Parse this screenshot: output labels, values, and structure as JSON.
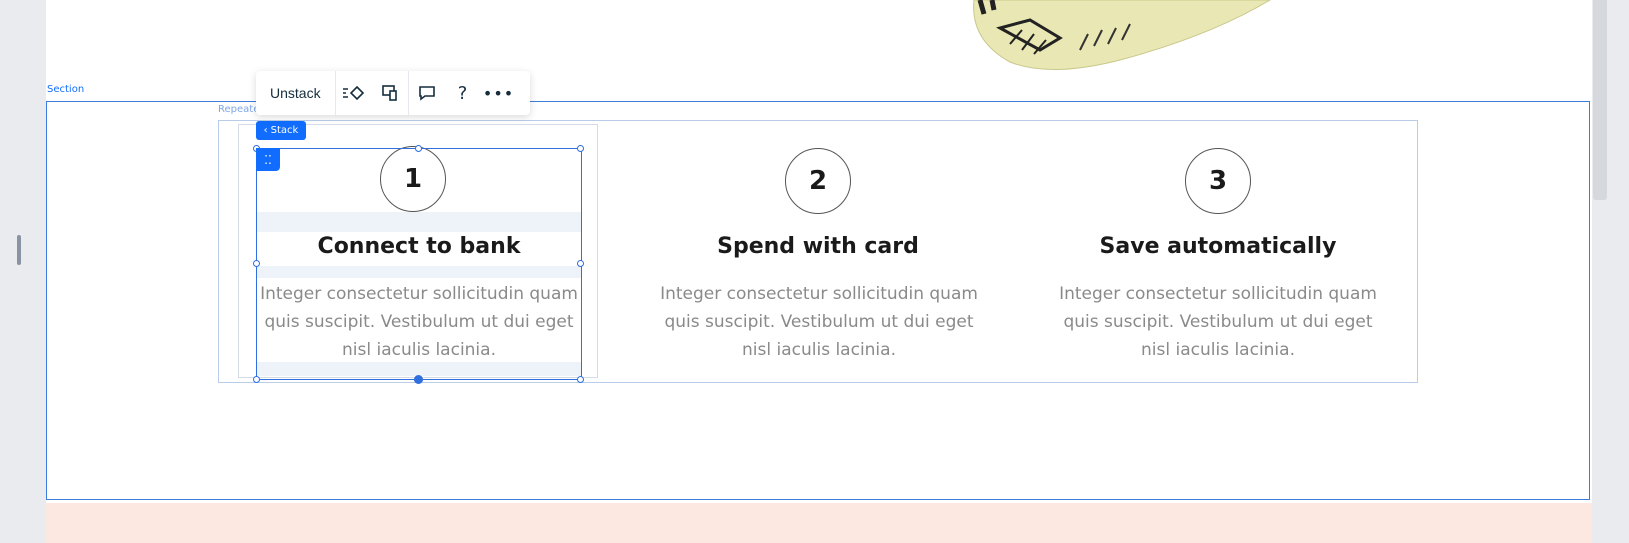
{
  "editor": {
    "section_label": "Section",
    "repeater_label": "Repeater",
    "stack_tag_label": "Stack",
    "toolbar": {
      "unstack_label": "Unstack"
    }
  },
  "steps": [
    {
      "number": "1",
      "title": "Connect to bank",
      "description": "Integer consectetur sollicitudin quam quis suscipit. Vestibulum ut dui eget nisl iaculis lacinia."
    },
    {
      "number": "2",
      "title": "Spend with card",
      "description": "Integer consectetur sollicitudin quam quis suscipit. Vestibulum ut dui eget nisl iaculis lacinia."
    },
    {
      "number": "3",
      "title": "Save automatically",
      "description": "Integer consectetur sollicitudin quam quis suscipit. Vestibulum ut dui eget nisl iaculis lacinia."
    }
  ],
  "colors": {
    "accent": "#116dff",
    "selection": "#2f6fe0",
    "footer_section": "#fde8e1"
  }
}
